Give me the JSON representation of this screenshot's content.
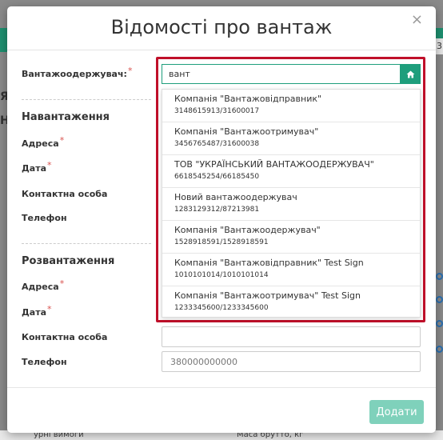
{
  "background": {
    "right_text": "3",
    "left_fragments": [
      "Я",
      "На"
    ],
    "bottom_left": "урні вимоги",
    "bottom_right": "Маса брутто, кг"
  },
  "modal": {
    "title": "Відомості про вантаж",
    "close_symbol": "×",
    "consignee_label": "Вантажоодержувач:",
    "required_mark": "*",
    "search": {
      "value": "вант",
      "button_icon": "home-icon"
    },
    "loading": {
      "title": "Навантаження",
      "address_label": "Адреса",
      "date_label": "Дата",
      "contact_label": "Контактна особа",
      "phone_label": "Телефон"
    },
    "unloading": {
      "title": "Розвантаження",
      "address_label": "Адреса",
      "date_label": "Дата",
      "contact_label": "Контактна особа",
      "phone_label": "Телефон",
      "phone_placeholder": "380000000000"
    },
    "dropdown_items": [
      {
        "name": "Компанія \"Вантажовідправник\"",
        "code": "3148615913/31600017"
      },
      {
        "name": "Компанія \"Вантажоотримувач\"",
        "code": "3456765487/31600038"
      },
      {
        "name": "ТОВ \"УКРАЇНСЬКИЙ ВАНТАЖООДЕРЖУВАЧ\"",
        "code": "6618545254/66185450"
      },
      {
        "name": "Новий вантажоодержувач",
        "code": "1283129312/87213981"
      },
      {
        "name": "Компанія \"Вантажоодержувач\"",
        "code": "1528918591/1528918591"
      },
      {
        "name": "Компанія \"Вантажовідправник\" Test Sign",
        "code": "1010101014/1010101014"
      },
      {
        "name": "Компанія \"Вантажоотримувач\" Test Sign",
        "code": "1233345600/1233345600"
      }
    ],
    "submit_label": "Додати"
  },
  "colors": {
    "accent": "#1e9e7c",
    "highlight": "#c0102a",
    "submit_disabled": "#7fd1bb"
  }
}
